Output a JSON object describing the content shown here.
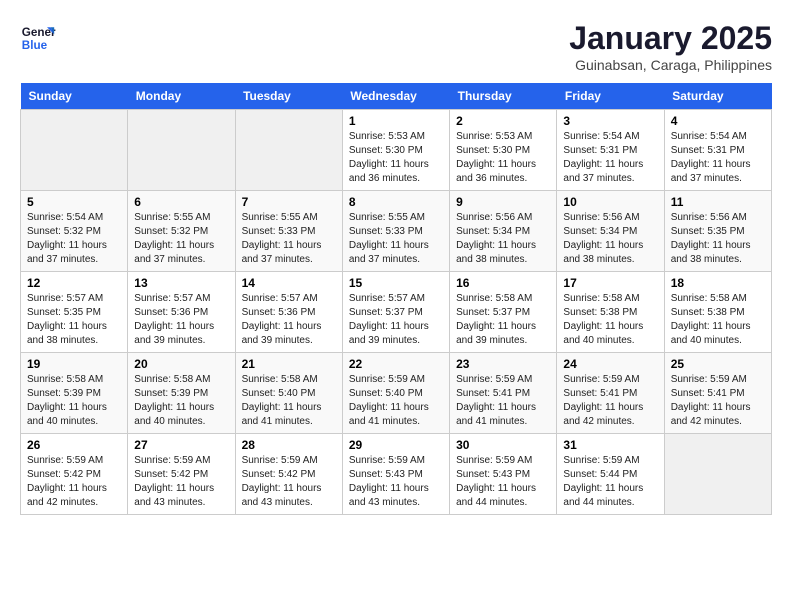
{
  "header": {
    "logo_line1": "General",
    "logo_line2": "Blue",
    "month": "January 2025",
    "location": "Guinabsan, Caraga, Philippines"
  },
  "days_of_week": [
    "Sunday",
    "Monday",
    "Tuesday",
    "Wednesday",
    "Thursday",
    "Friday",
    "Saturday"
  ],
  "weeks": [
    [
      {
        "day": "",
        "info": ""
      },
      {
        "day": "",
        "info": ""
      },
      {
        "day": "",
        "info": ""
      },
      {
        "day": "1",
        "info": "Sunrise: 5:53 AM\nSunset: 5:30 PM\nDaylight: 11 hours\nand 36 minutes."
      },
      {
        "day": "2",
        "info": "Sunrise: 5:53 AM\nSunset: 5:30 PM\nDaylight: 11 hours\nand 36 minutes."
      },
      {
        "day": "3",
        "info": "Sunrise: 5:54 AM\nSunset: 5:31 PM\nDaylight: 11 hours\nand 37 minutes."
      },
      {
        "day": "4",
        "info": "Sunrise: 5:54 AM\nSunset: 5:31 PM\nDaylight: 11 hours\nand 37 minutes."
      }
    ],
    [
      {
        "day": "5",
        "info": "Sunrise: 5:54 AM\nSunset: 5:32 PM\nDaylight: 11 hours\nand 37 minutes."
      },
      {
        "day": "6",
        "info": "Sunrise: 5:55 AM\nSunset: 5:32 PM\nDaylight: 11 hours\nand 37 minutes."
      },
      {
        "day": "7",
        "info": "Sunrise: 5:55 AM\nSunset: 5:33 PM\nDaylight: 11 hours\nand 37 minutes."
      },
      {
        "day": "8",
        "info": "Sunrise: 5:55 AM\nSunset: 5:33 PM\nDaylight: 11 hours\nand 37 minutes."
      },
      {
        "day": "9",
        "info": "Sunrise: 5:56 AM\nSunset: 5:34 PM\nDaylight: 11 hours\nand 38 minutes."
      },
      {
        "day": "10",
        "info": "Sunrise: 5:56 AM\nSunset: 5:34 PM\nDaylight: 11 hours\nand 38 minutes."
      },
      {
        "day": "11",
        "info": "Sunrise: 5:56 AM\nSunset: 5:35 PM\nDaylight: 11 hours\nand 38 minutes."
      }
    ],
    [
      {
        "day": "12",
        "info": "Sunrise: 5:57 AM\nSunset: 5:35 PM\nDaylight: 11 hours\nand 38 minutes."
      },
      {
        "day": "13",
        "info": "Sunrise: 5:57 AM\nSunset: 5:36 PM\nDaylight: 11 hours\nand 39 minutes."
      },
      {
        "day": "14",
        "info": "Sunrise: 5:57 AM\nSunset: 5:36 PM\nDaylight: 11 hours\nand 39 minutes."
      },
      {
        "day": "15",
        "info": "Sunrise: 5:57 AM\nSunset: 5:37 PM\nDaylight: 11 hours\nand 39 minutes."
      },
      {
        "day": "16",
        "info": "Sunrise: 5:58 AM\nSunset: 5:37 PM\nDaylight: 11 hours\nand 39 minutes."
      },
      {
        "day": "17",
        "info": "Sunrise: 5:58 AM\nSunset: 5:38 PM\nDaylight: 11 hours\nand 40 minutes."
      },
      {
        "day": "18",
        "info": "Sunrise: 5:58 AM\nSunset: 5:38 PM\nDaylight: 11 hours\nand 40 minutes."
      }
    ],
    [
      {
        "day": "19",
        "info": "Sunrise: 5:58 AM\nSunset: 5:39 PM\nDaylight: 11 hours\nand 40 minutes."
      },
      {
        "day": "20",
        "info": "Sunrise: 5:58 AM\nSunset: 5:39 PM\nDaylight: 11 hours\nand 40 minutes."
      },
      {
        "day": "21",
        "info": "Sunrise: 5:58 AM\nSunset: 5:40 PM\nDaylight: 11 hours\nand 41 minutes."
      },
      {
        "day": "22",
        "info": "Sunrise: 5:59 AM\nSunset: 5:40 PM\nDaylight: 11 hours\nand 41 minutes."
      },
      {
        "day": "23",
        "info": "Sunrise: 5:59 AM\nSunset: 5:41 PM\nDaylight: 11 hours\nand 41 minutes."
      },
      {
        "day": "24",
        "info": "Sunrise: 5:59 AM\nSunset: 5:41 PM\nDaylight: 11 hours\nand 42 minutes."
      },
      {
        "day": "25",
        "info": "Sunrise: 5:59 AM\nSunset: 5:41 PM\nDaylight: 11 hours\nand 42 minutes."
      }
    ],
    [
      {
        "day": "26",
        "info": "Sunrise: 5:59 AM\nSunset: 5:42 PM\nDaylight: 11 hours\nand 42 minutes."
      },
      {
        "day": "27",
        "info": "Sunrise: 5:59 AM\nSunset: 5:42 PM\nDaylight: 11 hours\nand 43 minutes."
      },
      {
        "day": "28",
        "info": "Sunrise: 5:59 AM\nSunset: 5:42 PM\nDaylight: 11 hours\nand 43 minutes."
      },
      {
        "day": "29",
        "info": "Sunrise: 5:59 AM\nSunset: 5:43 PM\nDaylight: 11 hours\nand 43 minutes."
      },
      {
        "day": "30",
        "info": "Sunrise: 5:59 AM\nSunset: 5:43 PM\nDaylight: 11 hours\nand 44 minutes."
      },
      {
        "day": "31",
        "info": "Sunrise: 5:59 AM\nSunset: 5:44 PM\nDaylight: 11 hours\nand 44 minutes."
      },
      {
        "day": "",
        "info": ""
      }
    ]
  ]
}
